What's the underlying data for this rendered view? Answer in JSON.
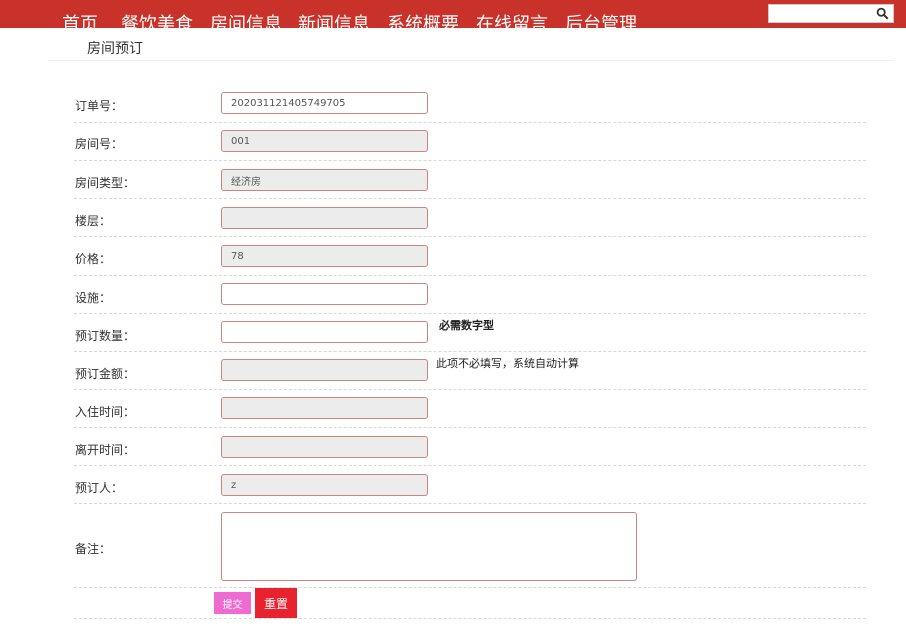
{
  "nav": {
    "items": [
      {
        "label": "首页"
      },
      {
        "label": "餐饮美食"
      },
      {
        "label": "房间信息"
      },
      {
        "label": "新闻信息"
      },
      {
        "label": "系统概要"
      },
      {
        "label": "在线留言"
      },
      {
        "label": "后台管理"
      }
    ],
    "search_icon": "search-icon"
  },
  "page": {
    "title": "房间预订"
  },
  "form": {
    "fields": [
      {
        "label": "订单号：",
        "value": "202031121405749705",
        "readonly": false
      },
      {
        "label": "房间号：",
        "value": "001",
        "readonly": true
      },
      {
        "label": "房间类型：",
        "value": "经济房",
        "readonly": true
      },
      {
        "label": "楼层：",
        "value": "",
        "readonly": true
      },
      {
        "label": "价格：",
        "value": "78",
        "readonly": true
      },
      {
        "label": "设施：",
        "value": "",
        "readonly": false
      },
      {
        "label": "预订数量：",
        "value": "",
        "readonly": false
      },
      {
        "label": "预订金额：",
        "value": "",
        "readonly": true
      },
      {
        "label": "入住时间：",
        "value": "",
        "readonly": true
      },
      {
        "label": "离开时间：",
        "value": "",
        "readonly": true
      },
      {
        "label": "预订人：",
        "value": "z",
        "readonly": true
      }
    ],
    "hints": {
      "quantity": "必需数字型",
      "amount": "此项不必填写，系统自动计算"
    },
    "memo_label": "备注：",
    "memo_value": "",
    "submit_label": "提交",
    "reset_label": "重置"
  },
  "colors": {
    "header_bg": "#c8322a",
    "submit_bg": "#f06bd0",
    "reset_bg": "#e8232f"
  }
}
